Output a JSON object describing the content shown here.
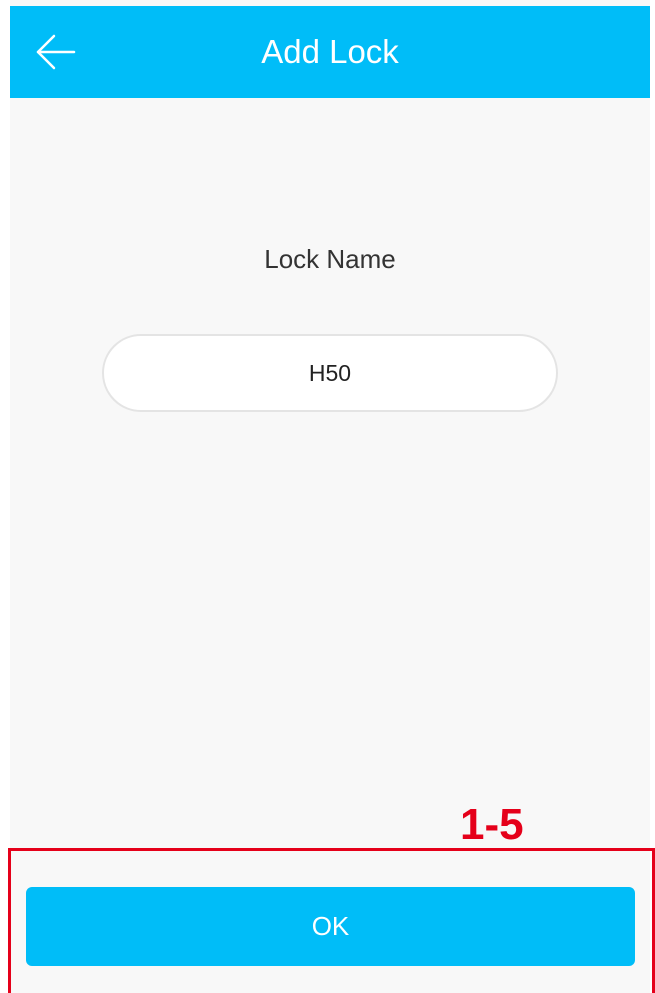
{
  "header": {
    "title": "Add Lock",
    "back_icon": "arrow-left-icon"
  },
  "form": {
    "label": "Lock Name",
    "input_value": "H50"
  },
  "annotation": {
    "step": "1-5",
    "color": "#e5001a"
  },
  "footer": {
    "ok_label": "OK"
  },
  "colors": {
    "accent": "#00bdf8",
    "background": "#f8f8f8"
  }
}
